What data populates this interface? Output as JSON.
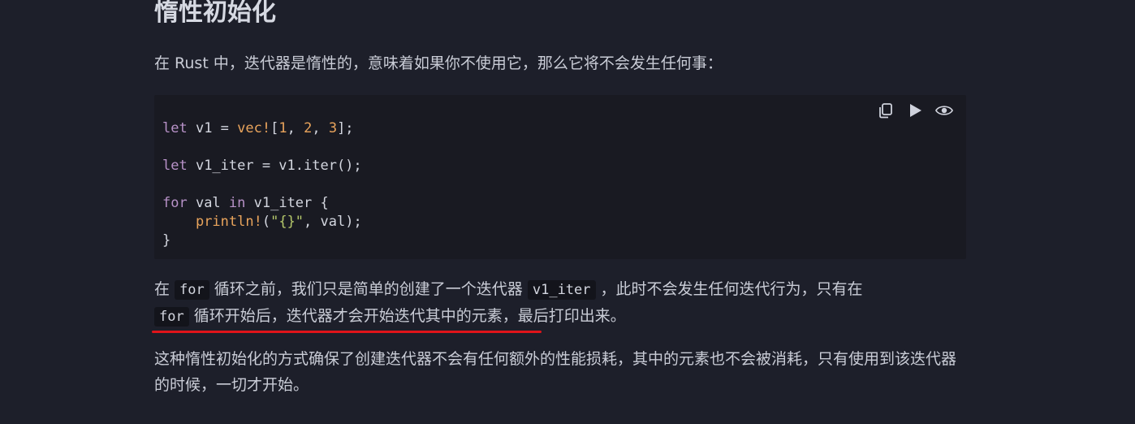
{
  "section": {
    "heading": "惰性初始化",
    "intro": "在 Rust 中，迭代器是惰性的，意味着如果你不使用它，那么它将不会发生任何事："
  },
  "code_block": {
    "lines": {
      "l1_let": "let",
      "l1_a": " v1 = ",
      "l1_mac": "vec!",
      "l1_b": "[",
      "l1_n1": "1",
      "l1_c": ", ",
      "l1_n2": "2",
      "l1_d": ", ",
      "l1_n3": "3",
      "l1_e": "];",
      "l2_let": "let",
      "l2_a": " v1_iter = v1.iter();",
      "l3_for": "for",
      "l3_a": " val ",
      "l3_in": "in",
      "l3_b": " v1_iter {",
      "l4_indent": "    ",
      "l4_mac": "println!",
      "l4_a": "(",
      "l4_str": "\"{}\"",
      "l4_b": ", val);",
      "l5": "}"
    },
    "toolbar": {
      "copy_icon": "copy-icon",
      "run_icon": "play-icon",
      "show_icon": "eye-icon"
    }
  },
  "para2": {
    "t1": "在 ",
    "code1": "for",
    "t2": " 循环之前，我们只是简单的创建了一个迭代器 ",
    "code2": "v1_iter",
    "t3": " ，此时不会发生任何迭代行为，只有在",
    "code3": "for",
    "t4": " 循环开始后，迭代器才会开始迭代其中的元素，最后打印出来。"
  },
  "para3": {
    "text": "这种惰性初始化的方式确保了创建迭代器不会有任何额外的性能损耗，其中的元素也不会被消耗，只有使用到该迭代器的时候，一切才开始。"
  },
  "colors": {
    "background": "#1d1f2a",
    "code_bg": "#191a22",
    "annotation_underline": "#e0141a"
  }
}
